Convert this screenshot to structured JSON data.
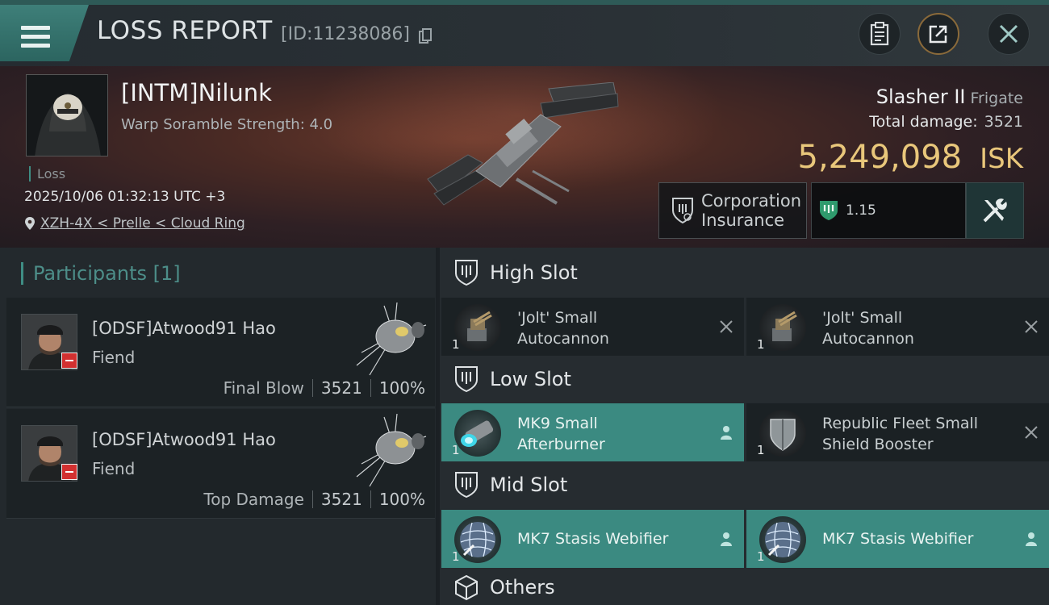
{
  "header": {
    "title": "LOSS REPORT",
    "report_id": "[ID:11238086]"
  },
  "victim": {
    "name": "[INTM]Nilunk",
    "scramble": "Warp Soramble Strength: 4.0",
    "result": "Loss",
    "datetime": "2025/10/06 01:32:13 UTC +3",
    "location": "XZH-4X < Prelle < Cloud Ring"
  },
  "ship": {
    "name": "Slasher II",
    "class": "Frigate",
    "total_damage_label": "Total damage:",
    "total_damage": "3521",
    "isk_value": "5,249,098",
    "isk_unit": "ISK"
  },
  "insurance": {
    "label_line1": "Corporation",
    "label_line2": "Insurance",
    "multiplier": "1.15"
  },
  "participants": {
    "title": "Participants",
    "count": "[1]",
    "rows": [
      {
        "name": "[ODSF]Atwood91 Hao",
        "ship": "Fiend",
        "role": "Final Blow",
        "damage": "3521",
        "percent": "100%"
      },
      {
        "name": "[ODSF]Atwood91 Hao",
        "ship": "Fiend",
        "role": "Top Damage",
        "damage": "3521",
        "percent": "100%"
      }
    ]
  },
  "slots": {
    "high": {
      "title": "High Slot",
      "modules": [
        {
          "line1": "'Jolt' Small",
          "line2": "Autocannon",
          "qty": "1",
          "status": "destroyed"
        },
        {
          "line1": "'Jolt' Small",
          "line2": "Autocannon",
          "qty": "1",
          "status": "destroyed"
        }
      ]
    },
    "low": {
      "title": "Low Slot",
      "modules": [
        {
          "line1": "MK9 Small",
          "line2": "Afterburner",
          "qty": "1",
          "status": "dropped"
        },
        {
          "line1": "Republic Fleet Small",
          "line2": "Shield Booster",
          "qty": "1",
          "status": "destroyed"
        }
      ]
    },
    "mid": {
      "title": "Mid Slot",
      "modules": [
        {
          "line1": "MK7 Stasis Webifier",
          "qty": "1",
          "status": "dropped"
        },
        {
          "line1": "MK7 Stasis Webifier",
          "qty": "1",
          "status": "dropped"
        }
      ]
    },
    "others": {
      "title": "Others"
    }
  },
  "icons": {
    "menu": "menu-icon",
    "copy": "copy-icon",
    "clipboard": "clipboard-icon",
    "share": "share-icon",
    "close": "close-icon",
    "location": "location-pin-icon",
    "insurance": "insurance-shield-icon",
    "fitting": "wrench-screwdriver-icon",
    "slot": "slot-shield-icon",
    "others": "cube-icon",
    "destroyed": "x-icon",
    "dropped": "person-icon"
  },
  "colors": {
    "accent": "#3b8a81",
    "isk": "#e9c77b",
    "badge": "#d23030"
  }
}
